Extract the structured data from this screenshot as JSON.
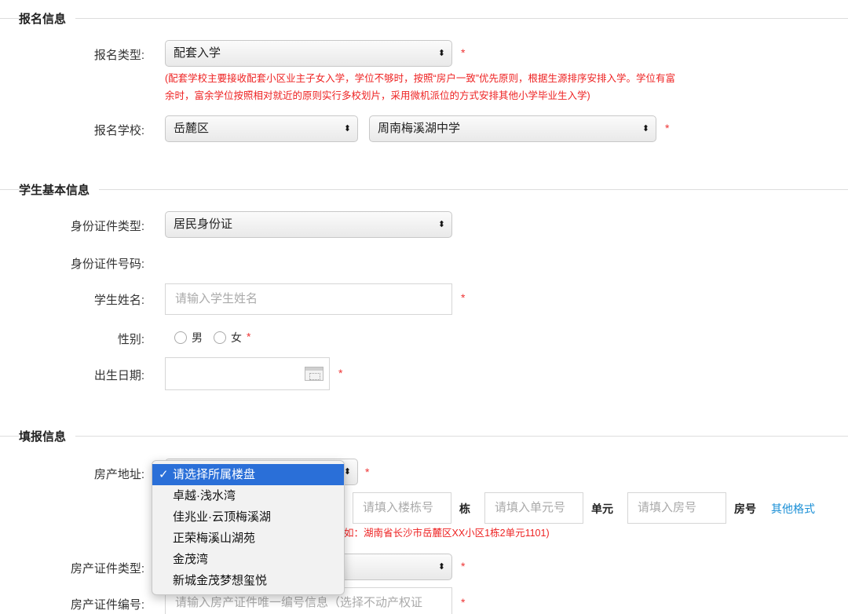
{
  "sections": {
    "signup": "报名信息",
    "student": "学生基本信息",
    "fill": "填报信息"
  },
  "signup": {
    "type_label": "报名类型:",
    "type_value": "配套入学",
    "note_line1": "(配套学校主要接收配套小区业主子女入学，学位不够时，按照“房户一致”优先原则，根据生源排序安排入学。学位有富",
    "note_line2": "余时，富余学位按照相对就近的原则实行多校划片，采用微机派位的方式安排其他小学毕业生入学)",
    "school_label": "报名学校:",
    "district_value": "岳麓区",
    "school_value": "周南梅溪湖中学"
  },
  "student": {
    "id_type_label": "身份证件类型:",
    "id_type_value": "居民身份证",
    "id_no_label": "身份证件号码:",
    "name_label": "学生姓名:",
    "name_placeholder": "请输入学生姓名",
    "gender_label": "性别:",
    "gender_male": "男",
    "gender_female": "女",
    "birth_label": "出生日期:"
  },
  "fill": {
    "address_label": "房产地址:",
    "building_placeholder": "请填入楼栋号",
    "building_unit": "栋",
    "unit_placeholder": "请填入单元号",
    "unit_unit": "单元",
    "room_placeholder": "请填入房号",
    "room_unit": "房号",
    "other_format": "其他格式",
    "address_hint": "如：湖南省长沙市岳麓区XX小区1栋2单元1101)",
    "cert_type_label": "房产证件类型:",
    "cert_no_label": "房产证件编号:",
    "cert_no_placeholder": "请输入房产证件唯一编号信息（选择不动产权证"
  },
  "required_mark": "*",
  "dropdown": {
    "check": "✓",
    "options": [
      "请选择所属楼盘",
      "卓越·浅水湾",
      "佳兆业·云顶梅溪湖",
      "正荣梅溪山湖苑",
      "金茂湾",
      "新城金茂梦想玺悦"
    ],
    "selected_index": 0
  },
  "colors": {
    "required": "#e33333",
    "link": "#1a8fd6",
    "highlight": "#2a6fd8"
  }
}
